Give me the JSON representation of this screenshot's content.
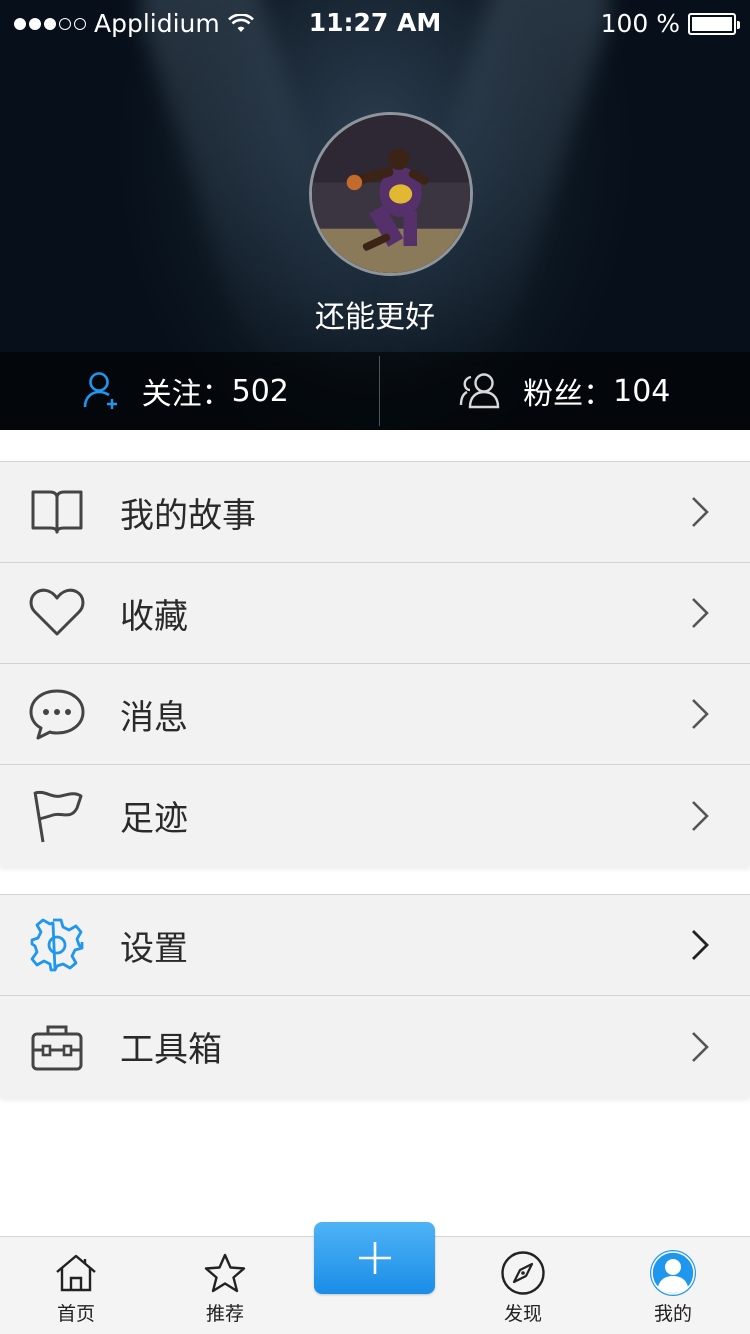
{
  "status_bar": {
    "carrier": "Applidium",
    "time": "11:27 AM",
    "battery": "100 %",
    "signal_bars_filled": 3,
    "signal_bars_total": 5
  },
  "profile": {
    "username": "还能更好",
    "following_label": "关注：",
    "following_count": "502",
    "followers_label": "粉丝：",
    "followers_count": "104"
  },
  "menu_group_1": [
    {
      "label": "我的故事",
      "icon": "book-icon"
    },
    {
      "label": "收藏",
      "icon": "heart-icon"
    },
    {
      "label": "消息",
      "icon": "chat-bubble-icon"
    },
    {
      "label": "足迹",
      "icon": "flag-icon"
    }
  ],
  "menu_group_2": [
    {
      "label": "设置",
      "icon": "gear-icon"
    },
    {
      "label": "工具箱",
      "icon": "toolbox-icon"
    }
  ],
  "tabbar": {
    "home": "首页",
    "recommend": "推荐",
    "discover": "发现",
    "mine": "我的"
  },
  "colors": {
    "accent": "#1f97ee",
    "header_bg": "#0f1a24",
    "menu_bg": "#f2f2f2"
  }
}
